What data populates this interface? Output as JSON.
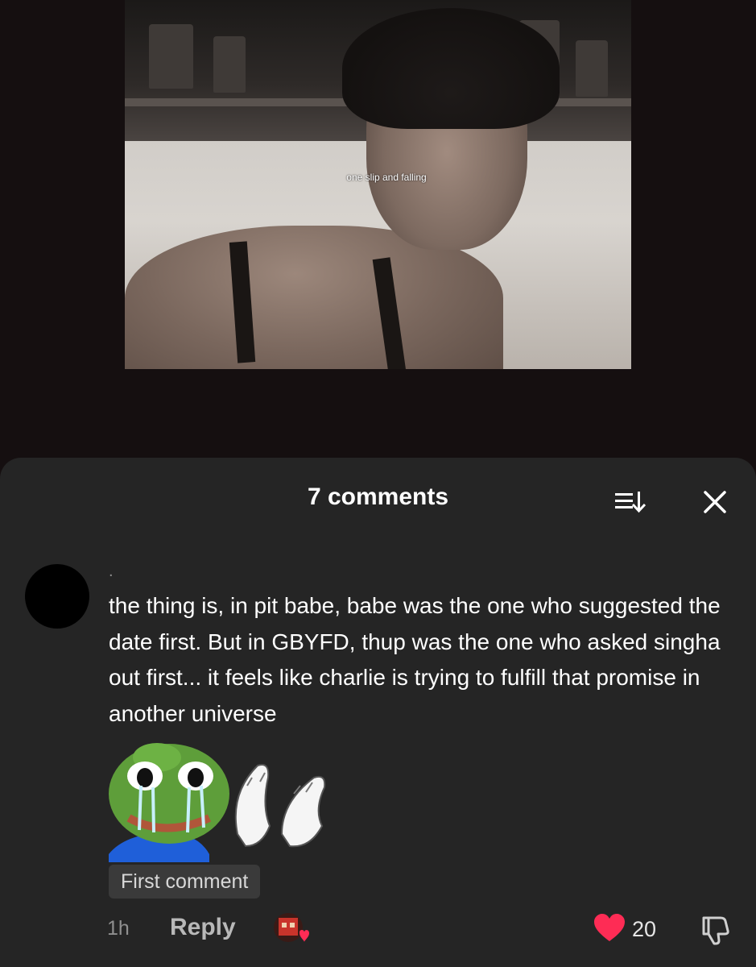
{
  "video": {
    "overlay_text": "one slip and falling"
  },
  "comments_sheet": {
    "title": "7 comments",
    "sort_icon": "sort-icon",
    "close_icon": "close-icon"
  },
  "comment": {
    "username": ".",
    "text": "the thing is, in pit babe, babe was the one who suggested the date first. But in GBYFD, thup was the one who asked singha out first... it feels like charlie is trying to fulfill that promise in another universe",
    "sticker": "crying-frog-clapping-sticker",
    "badge": "First comment",
    "time": "1h",
    "reply_label": "Reply",
    "like_count": "20",
    "like_color": "#fe2c55"
  }
}
